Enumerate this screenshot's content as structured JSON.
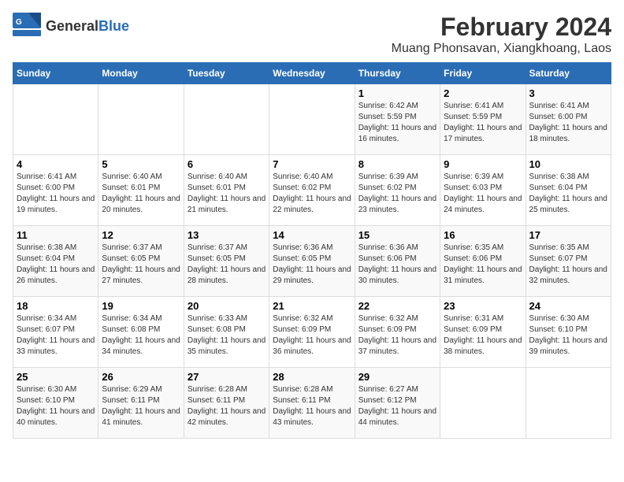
{
  "logo": {
    "text_general": "General",
    "text_blue": "Blue"
  },
  "title": "February 2024",
  "subtitle": "Muang Phonsavan, Xiangkhoang, Laos",
  "days_of_week": [
    "Sunday",
    "Monday",
    "Tuesday",
    "Wednesday",
    "Thursday",
    "Friday",
    "Saturday"
  ],
  "weeks": [
    [
      {
        "day": "",
        "info": ""
      },
      {
        "day": "",
        "info": ""
      },
      {
        "day": "",
        "info": ""
      },
      {
        "day": "",
        "info": ""
      },
      {
        "day": "1",
        "info": "Sunrise: 6:42 AM\nSunset: 5:59 PM\nDaylight: 11 hours and 16 minutes."
      },
      {
        "day": "2",
        "info": "Sunrise: 6:41 AM\nSunset: 5:59 PM\nDaylight: 11 hours and 17 minutes."
      },
      {
        "day": "3",
        "info": "Sunrise: 6:41 AM\nSunset: 6:00 PM\nDaylight: 11 hours and 18 minutes."
      }
    ],
    [
      {
        "day": "4",
        "info": "Sunrise: 6:41 AM\nSunset: 6:00 PM\nDaylight: 11 hours and 19 minutes."
      },
      {
        "day": "5",
        "info": "Sunrise: 6:40 AM\nSunset: 6:01 PM\nDaylight: 11 hours and 20 minutes."
      },
      {
        "day": "6",
        "info": "Sunrise: 6:40 AM\nSunset: 6:01 PM\nDaylight: 11 hours and 21 minutes."
      },
      {
        "day": "7",
        "info": "Sunrise: 6:40 AM\nSunset: 6:02 PM\nDaylight: 11 hours and 22 minutes."
      },
      {
        "day": "8",
        "info": "Sunrise: 6:39 AM\nSunset: 6:02 PM\nDaylight: 11 hours and 23 minutes."
      },
      {
        "day": "9",
        "info": "Sunrise: 6:39 AM\nSunset: 6:03 PM\nDaylight: 11 hours and 24 minutes."
      },
      {
        "day": "10",
        "info": "Sunrise: 6:38 AM\nSunset: 6:04 PM\nDaylight: 11 hours and 25 minutes."
      }
    ],
    [
      {
        "day": "11",
        "info": "Sunrise: 6:38 AM\nSunset: 6:04 PM\nDaylight: 11 hours and 26 minutes."
      },
      {
        "day": "12",
        "info": "Sunrise: 6:37 AM\nSunset: 6:05 PM\nDaylight: 11 hours and 27 minutes."
      },
      {
        "day": "13",
        "info": "Sunrise: 6:37 AM\nSunset: 6:05 PM\nDaylight: 11 hours and 28 minutes."
      },
      {
        "day": "14",
        "info": "Sunrise: 6:36 AM\nSunset: 6:05 PM\nDaylight: 11 hours and 29 minutes."
      },
      {
        "day": "15",
        "info": "Sunrise: 6:36 AM\nSunset: 6:06 PM\nDaylight: 11 hours and 30 minutes."
      },
      {
        "day": "16",
        "info": "Sunrise: 6:35 AM\nSunset: 6:06 PM\nDaylight: 11 hours and 31 minutes."
      },
      {
        "day": "17",
        "info": "Sunrise: 6:35 AM\nSunset: 6:07 PM\nDaylight: 11 hours and 32 minutes."
      }
    ],
    [
      {
        "day": "18",
        "info": "Sunrise: 6:34 AM\nSunset: 6:07 PM\nDaylight: 11 hours and 33 minutes."
      },
      {
        "day": "19",
        "info": "Sunrise: 6:34 AM\nSunset: 6:08 PM\nDaylight: 11 hours and 34 minutes."
      },
      {
        "day": "20",
        "info": "Sunrise: 6:33 AM\nSunset: 6:08 PM\nDaylight: 11 hours and 35 minutes."
      },
      {
        "day": "21",
        "info": "Sunrise: 6:32 AM\nSunset: 6:09 PM\nDaylight: 11 hours and 36 minutes."
      },
      {
        "day": "22",
        "info": "Sunrise: 6:32 AM\nSunset: 6:09 PM\nDaylight: 11 hours and 37 minutes."
      },
      {
        "day": "23",
        "info": "Sunrise: 6:31 AM\nSunset: 6:09 PM\nDaylight: 11 hours and 38 minutes."
      },
      {
        "day": "24",
        "info": "Sunrise: 6:30 AM\nSunset: 6:10 PM\nDaylight: 11 hours and 39 minutes."
      }
    ],
    [
      {
        "day": "25",
        "info": "Sunrise: 6:30 AM\nSunset: 6:10 PM\nDaylight: 11 hours and 40 minutes."
      },
      {
        "day": "26",
        "info": "Sunrise: 6:29 AM\nSunset: 6:11 PM\nDaylight: 11 hours and 41 minutes."
      },
      {
        "day": "27",
        "info": "Sunrise: 6:28 AM\nSunset: 6:11 PM\nDaylight: 11 hours and 42 minutes."
      },
      {
        "day": "28",
        "info": "Sunrise: 6:28 AM\nSunset: 6:11 PM\nDaylight: 11 hours and 43 minutes."
      },
      {
        "day": "29",
        "info": "Sunrise: 6:27 AM\nSunset: 6:12 PM\nDaylight: 11 hours and 44 minutes."
      },
      {
        "day": "",
        "info": ""
      },
      {
        "day": "",
        "info": ""
      }
    ]
  ]
}
